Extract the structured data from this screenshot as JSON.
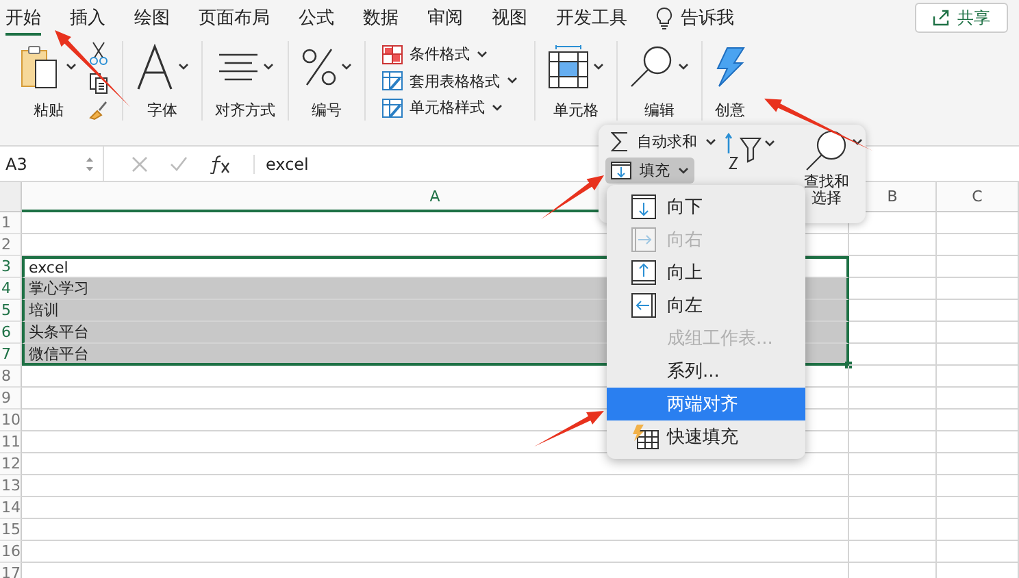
{
  "tabs": [
    {
      "label": "开始",
      "selected": true
    },
    {
      "label": "插入",
      "selected": false
    },
    {
      "label": "绘图",
      "selected": false
    },
    {
      "label": "页面布局",
      "selected": false
    },
    {
      "label": "公式",
      "selected": false
    },
    {
      "label": "数据",
      "selected": false
    },
    {
      "label": "审阅",
      "selected": false
    },
    {
      "label": "视图",
      "selected": false
    },
    {
      "label": "开发工具",
      "selected": false
    }
  ],
  "tell_me": "告诉我",
  "share_button": "共享",
  "ribbon": [
    {
      "kind": "paste",
      "label": "粘贴"
    },
    {
      "kind": "font",
      "label": "字体"
    },
    {
      "kind": "align",
      "label": "对齐方式"
    },
    {
      "kind": "number",
      "label": "编号"
    },
    {
      "kind": "styles",
      "items": [
        "条件格式",
        "套用表格格式",
        "单元格样式"
      ]
    },
    {
      "kind": "cells",
      "label": "单元格"
    },
    {
      "kind": "edit",
      "label": "编辑"
    },
    {
      "kind": "ideas",
      "label": "创意"
    }
  ],
  "formula_bar": {
    "name_box": "A3",
    "formula": "excel"
  },
  "columns": [
    {
      "label": "A",
      "selected": true
    },
    {
      "label": "B",
      "selected": false
    },
    {
      "label": "C",
      "selected": false
    }
  ],
  "rows": [
    {
      "number": "1",
      "selected": false,
      "active": false
    },
    {
      "number": "2",
      "selected": false,
      "active": false
    },
    {
      "number": "3",
      "value": "excel",
      "selected": true,
      "active": true
    },
    {
      "number": "4",
      "value": "掌心学习",
      "selected": true,
      "active": false
    },
    {
      "number": "5",
      "value": "培训",
      "selected": true,
      "active": false
    },
    {
      "number": "6",
      "value": "头条平台",
      "selected": true,
      "active": false
    },
    {
      "number": "7",
      "value": "微信平台",
      "selected": true,
      "active": false
    },
    {
      "number": "8",
      "selected": false,
      "active": false
    },
    {
      "number": "9",
      "selected": false,
      "active": false
    },
    {
      "number": "10",
      "selected": false,
      "active": false
    },
    {
      "number": "11",
      "selected": false,
      "active": false
    },
    {
      "number": "12",
      "selected": false,
      "active": false
    },
    {
      "number": "13",
      "selected": false,
      "active": false
    },
    {
      "number": "14",
      "selected": false,
      "active": false
    },
    {
      "number": "15",
      "selected": false,
      "active": false
    },
    {
      "number": "16",
      "selected": false,
      "active": false
    },
    {
      "number": "17",
      "selected": false,
      "active": false
    }
  ],
  "edit_panel": {
    "autosum": "自动求和",
    "fill": {
      "label": "填充",
      "pressed": true
    },
    "find_select": [
      "查找和",
      "选择"
    ]
  },
  "fill_menu": [
    {
      "kind": "down",
      "label": "向下",
      "disabled": false,
      "selected": false
    },
    {
      "kind": "right",
      "label": "向右",
      "disabled": true,
      "selected": false
    },
    {
      "kind": "up",
      "label": "向上",
      "disabled": false,
      "selected": false
    },
    {
      "kind": "left",
      "label": "向左",
      "disabled": false,
      "selected": false
    },
    {
      "kind": "plain",
      "label": "成组工作表...",
      "disabled": true,
      "selected": false
    },
    {
      "kind": "plain",
      "label": "系列...",
      "disabled": false,
      "selected": false
    },
    {
      "kind": "plain",
      "label": "两端对齐",
      "disabled": false,
      "selected": true
    },
    {
      "kind": "flash",
      "label": "快速填充",
      "disabled": false,
      "selected": false
    }
  ]
}
